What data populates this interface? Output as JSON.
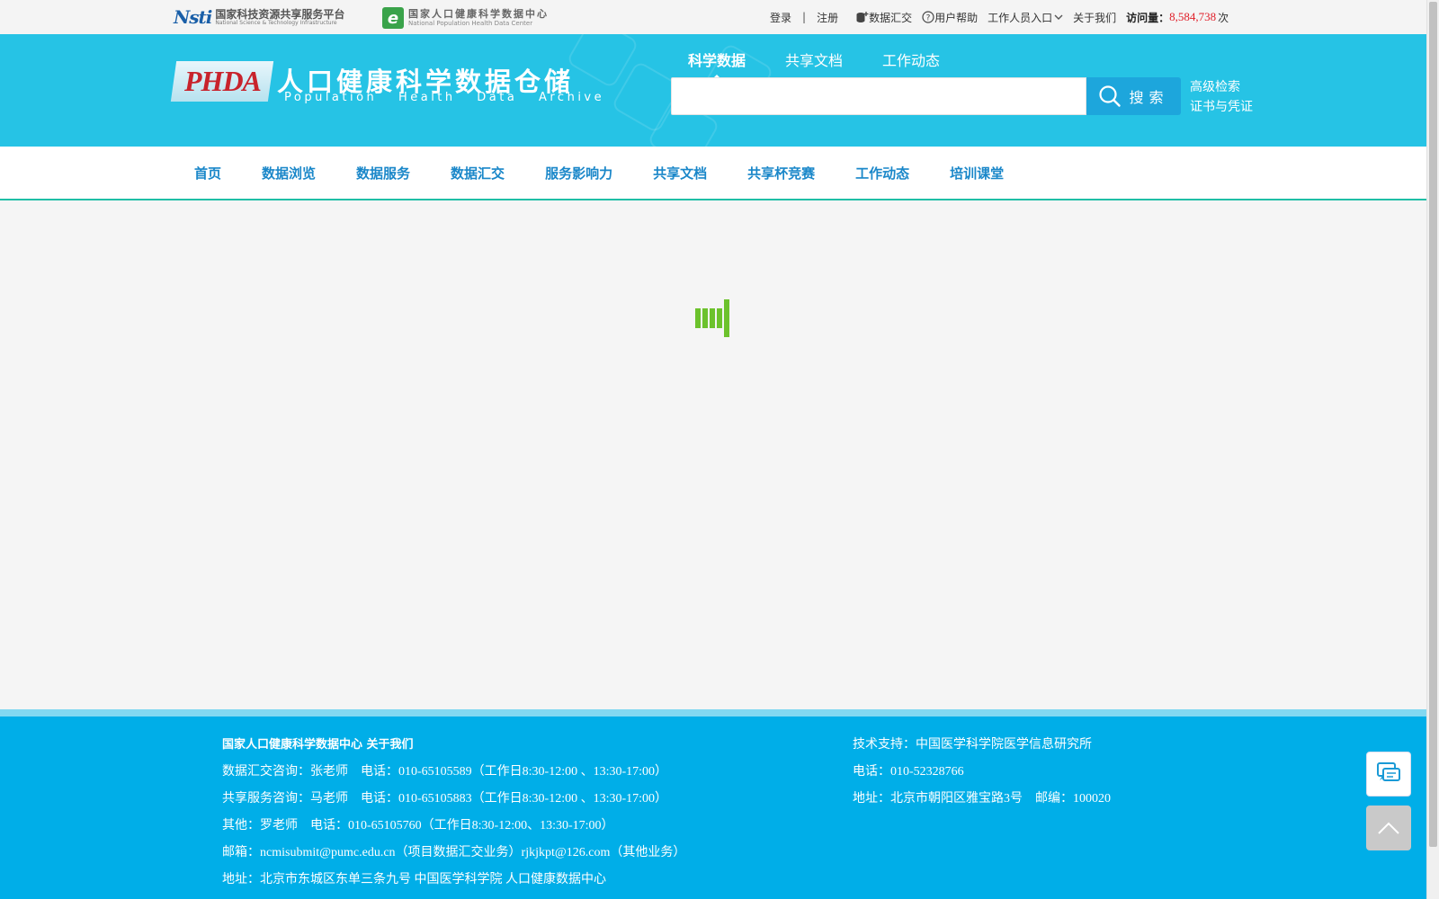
{
  "topbar": {
    "logo1": {
      "mark": "Nsti",
      "cn": "国家科技资源共享服务平台",
      "en": "National Science & Technology Infrastructure"
    },
    "logo2": {
      "mark": "e",
      "cn": "国家人口健康科学数据中心",
      "en": "National Population Health Data Center"
    },
    "login": "登录",
    "separator": "|",
    "register": "注册",
    "submit_data": "数据汇交",
    "help": "用户帮助",
    "staff": "工作人员入口",
    "about": "关于我们",
    "visit_label": "访问量：",
    "visit_count": "8,584,738",
    "visit_unit": "次"
  },
  "header": {
    "logo_text": "PHDA",
    "title": "人口健康科学数据仓储",
    "subtitle": [
      "Population",
      "Health",
      "Data",
      "Archive"
    ],
    "search_tabs": [
      {
        "label": "科学数据",
        "active": true
      },
      {
        "label": "共享文档",
        "active": false
      },
      {
        "label": "工作动态",
        "active": false
      }
    ],
    "search_placeholder": "",
    "search_button": "搜索",
    "advanced_search": "高级检索",
    "certificate": "证书与凭证"
  },
  "nav": {
    "items": [
      "首页",
      "数据浏览",
      "数据服务",
      "数据汇交",
      "服务影响力",
      "共享文档",
      "共享杯竞赛",
      "工作动态",
      "培训课堂"
    ]
  },
  "footer": {
    "left": {
      "title": "国家人口健康科学数据中心 关于我们",
      "line1": "数据汇交咨询：张老师　电话：010-65105589（工作日8:30-12:00 、13:30-17:00）",
      "line2": "共享服务咨询：马老师　电话：010-65105883（工作日8:30-12:00 、13:30-17:00）",
      "line3": "其他：罗老师　电话：010-65105760（工作日8:30-12:00、13:30-17:00）",
      "line4": "邮箱：ncmisubmit@pumc.edu.cn（项目数据汇交业务）rjkjkpt@126.com（其他业务）",
      "line5": "地址：北京市东城区东单三条九号 中国医学科学院 人口健康数据中心"
    },
    "right": {
      "line1": "技术支持：中国医学科学院医学信息研究所",
      "line2": "电话：010-52328766",
      "line3": "地址：北京市朝阳区雅宝路3号　邮编：100020"
    }
  },
  "colors": {
    "header_bg": "#26c3e5",
    "nav_text": "#1a87c9",
    "footer_bg": "#00aee8",
    "loader": "#6cc22c",
    "visit_count": "#e0202a"
  },
  "icons": [
    "database-plus-icon",
    "help-circle-icon",
    "chevron-down-icon",
    "search-icon",
    "chat-icon",
    "back-to-top-icon"
  ]
}
